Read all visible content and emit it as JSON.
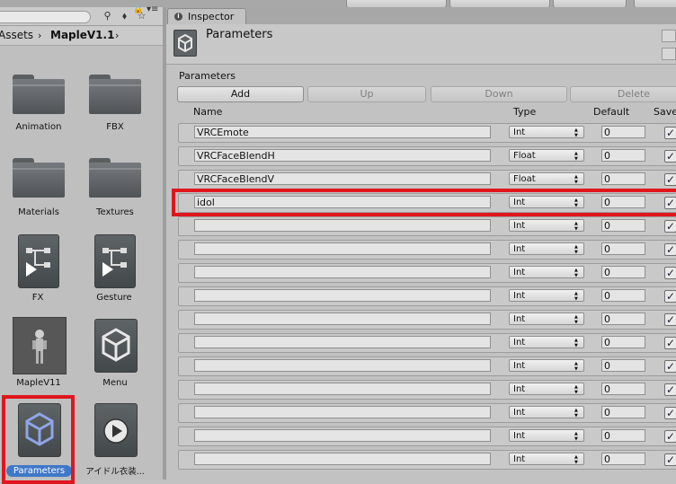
{
  "project": {
    "breadcrumb": [
      "Assets",
      "MapleV1.1"
    ],
    "assets": [
      {
        "label": "Animation",
        "kind": "folder"
      },
      {
        "label": "FBX",
        "kind": "folder"
      },
      {
        "label": "Materials",
        "kind": "folder"
      },
      {
        "label": "Textures",
        "kind": "folder"
      },
      {
        "label": "FX",
        "kind": "controller"
      },
      {
        "label": "Gesture",
        "kind": "controller"
      },
      {
        "label": "MapleV11",
        "kind": "prefab"
      },
      {
        "label": "Menu",
        "kind": "unity"
      },
      {
        "label": "Parameters",
        "kind": "unity",
        "selected": true
      },
      {
        "label": "アイドル衣装...",
        "kind": "anim"
      }
    ]
  },
  "inspector": {
    "tab_label": "Inspector",
    "header_title": "Parameters",
    "section_label": "Parameters",
    "buttons": {
      "add": "Add",
      "up": "Up",
      "down": "Down",
      "delete": "Delete"
    },
    "columns": {
      "name": "Name",
      "type": "Type",
      "default": "Default",
      "saved": "Save"
    },
    "rows": [
      {
        "name": "VRCEmote",
        "type": "Int",
        "default": "0",
        "saved": true
      },
      {
        "name": "VRCFaceBlendH",
        "type": "Float",
        "default": "0",
        "saved": true
      },
      {
        "name": "VRCFaceBlendV",
        "type": "Float",
        "default": "0",
        "saved": true
      },
      {
        "name": "idol",
        "type": "Int",
        "default": "0",
        "saved": true,
        "highlighted": true
      },
      {
        "name": "",
        "type": "Int",
        "default": "0",
        "saved": true
      },
      {
        "name": "",
        "type": "Int",
        "default": "0",
        "saved": true
      },
      {
        "name": "",
        "type": "Int",
        "default": "0",
        "saved": true
      },
      {
        "name": "",
        "type": "Int",
        "default": "0",
        "saved": true
      },
      {
        "name": "",
        "type": "Int",
        "default": "0",
        "saved": true
      },
      {
        "name": "",
        "type": "Int",
        "default": "0",
        "saved": true
      },
      {
        "name": "",
        "type": "Int",
        "default": "0",
        "saved": true
      },
      {
        "name": "",
        "type": "Int",
        "default": "0",
        "saved": true
      },
      {
        "name": "",
        "type": "Int",
        "default": "0",
        "saved": true
      },
      {
        "name": "",
        "type": "Int",
        "default": "0",
        "saved": true
      },
      {
        "name": "",
        "type": "Int",
        "default": "0",
        "saved": true
      }
    ]
  },
  "colors": {
    "highlight": "#e0161e",
    "selection": "#3f78c8"
  }
}
